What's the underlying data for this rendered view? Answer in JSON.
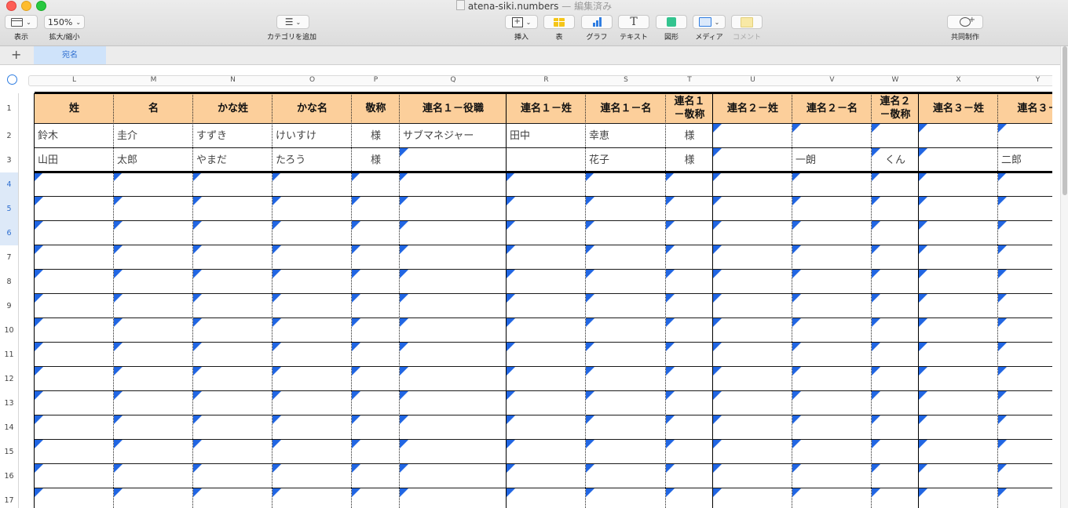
{
  "window": {
    "filename": "atena-siki.numbers",
    "status": "— 編集済み"
  },
  "toolbar": {
    "view": {
      "label": "表示"
    },
    "zoom": {
      "value": "150%",
      "label": "拡大/縮小"
    },
    "category": {
      "label": "カテゴリを追加"
    },
    "insert": {
      "label": "挿入"
    },
    "table": {
      "label": "表"
    },
    "chart": {
      "label": "グラフ"
    },
    "text": {
      "label": "テキスト"
    },
    "shape": {
      "label": "図形"
    },
    "media": {
      "label": "メディア"
    },
    "comment": {
      "label": "コメント"
    },
    "collaborate": {
      "label": "共同制作"
    }
  },
  "tabs": {
    "add_symbol": "+",
    "active_sheet": "宛名"
  },
  "grid": {
    "columns": [
      "L",
      "M",
      "N",
      "O",
      "P",
      "Q",
      "R",
      "S",
      "T",
      "U",
      "V",
      "W",
      "X",
      "Y"
    ],
    "row_numbers": [
      "1",
      "2",
      "3",
      "4",
      "5",
      "6",
      "7",
      "8",
      "9",
      "10",
      "11",
      "12",
      "13",
      "14",
      "15",
      "16",
      "17"
    ],
    "header_row": [
      "姓",
      "名",
      "かな姓",
      "かな名",
      "敬称",
      "連名１－役職",
      "連名１－姓",
      "連名１－名",
      "連名１\n－敬称",
      "連名２－姓",
      "連名２－名",
      "連名２\n－敬称",
      "連名３－姓",
      "連名３－"
    ],
    "rows": [
      [
        "鈴木",
        "圭介",
        "すずき",
        "けいすけ",
        "様",
        "サブマネジャー",
        "田中",
        "幸恵",
        "様",
        "",
        "",
        "",
        "",
        ""
      ],
      [
        "山田",
        "太郎",
        "やまだ",
        "たろう",
        "様",
        "",
        "",
        "花子",
        "様",
        "",
        "一朗",
        "くん",
        "",
        "二郎"
      ]
    ]
  },
  "colors": {
    "header_fill": "#fccf9b",
    "formula_flag": "#2166e3",
    "selection": "#2f7de1"
  }
}
